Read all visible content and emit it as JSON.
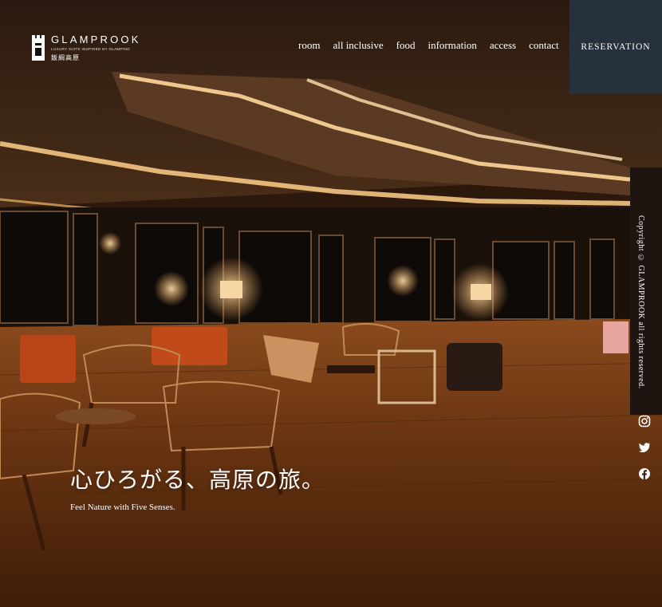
{
  "brand": {
    "name": "GLAMPROOK",
    "tagline": "LUXURY SUITE INSPIRED BY GLAMPING",
    "location_jp": "飯綱高原"
  },
  "nav": {
    "items": [
      "room",
      "all inclusive",
      "food",
      "information",
      "access",
      "contact"
    ]
  },
  "reservation": {
    "label": "RESERVATION",
    "bg_color": "#27303d"
  },
  "hero": {
    "headline_jp": "心ひろがる、高原の旅。",
    "subheadline": "Feel Nature with Five Senses."
  },
  "sidebar": {
    "copyright": "Copyright © GLAMPROOK all rights reserved.",
    "social_icons": [
      "instagram-icon",
      "twitter-icon",
      "facebook-icon"
    ]
  }
}
